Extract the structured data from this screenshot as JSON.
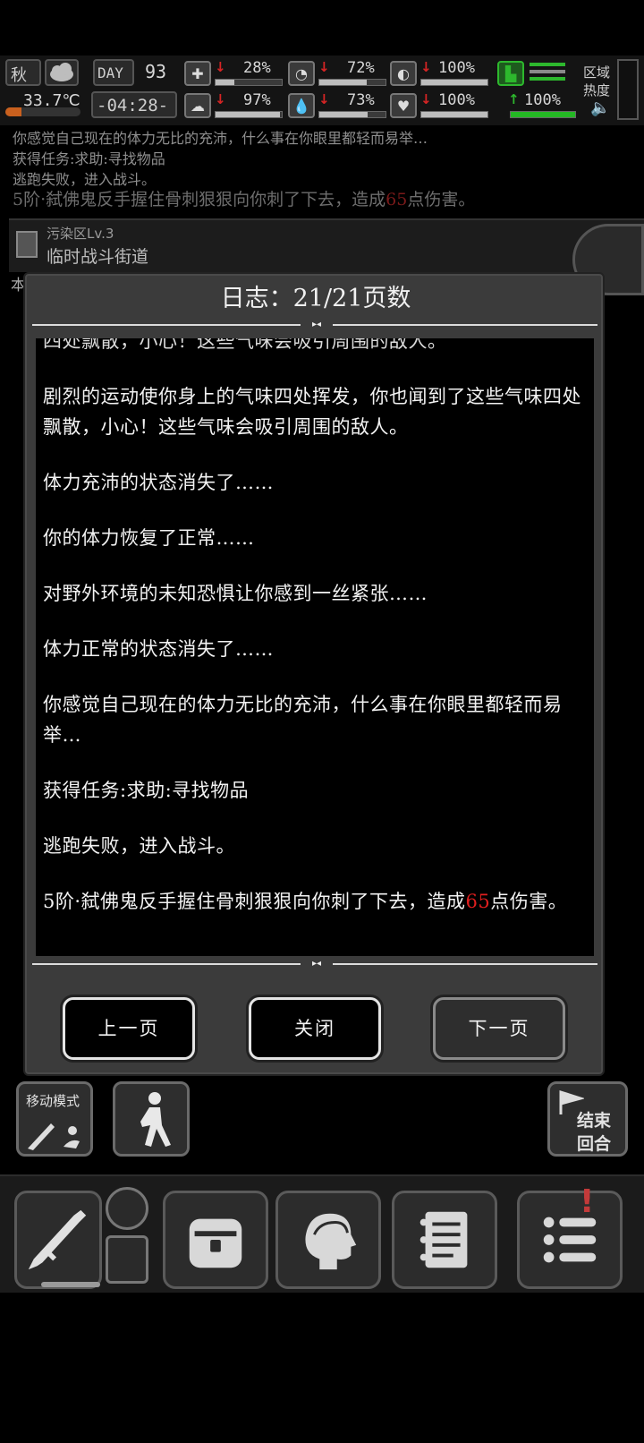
{
  "hud": {
    "season": "秋",
    "day_label": "DAY",
    "day": "93",
    "temperature": "33.7℃",
    "time": "-04:28-",
    "stats": [
      {
        "name": "health",
        "icon": "medkit-icon",
        "trend": "down",
        "value": "28%",
        "fill": 0.28
      },
      {
        "name": "hunger",
        "icon": "stomach-icon",
        "trend": "down",
        "value": "72%",
        "fill": 0.72
      },
      {
        "name": "protection",
        "icon": "armor-icon",
        "trend": "down",
        "value": "100%",
        "fill": 1.0
      },
      {
        "name": "sanity",
        "icon": "brain-icon",
        "trend": "down",
        "value": "97%",
        "fill": 0.97
      },
      {
        "name": "thirst",
        "icon": "water-drop-icon",
        "trend": "down",
        "value": "73%",
        "fill": 0.73
      },
      {
        "name": "heart",
        "icon": "heart-icon",
        "trend": "down",
        "value": "100%",
        "fill": 1.0
      },
      {
        "name": "stamina",
        "icon": "boot-icon",
        "trend": "up",
        "value": "100%",
        "fill": 1.0
      }
    ],
    "zone_heat_label_1": "区域",
    "zone_heat_label_2": "热度"
  },
  "messages": {
    "line1": "你感觉自己现在的体力无比的充沛，什么事在你眼里都轻而易举…",
    "line2": "获得任务:求助:寻找物品",
    "line3": "逃跑失败，进入战斗。",
    "line4_prefix": "5阶·弑佛鬼反手握住骨刺狠狠向你刺了下去，造成",
    "line4_dmg": "65",
    "line4_suffix": "点伤害。"
  },
  "zone": {
    "level": "污染区Lv.3",
    "name": "临时战斗街道",
    "side_char": "本"
  },
  "dialog": {
    "title": "日志：21/21页数",
    "entries": [
      "四处飘散，小心！这些气味会吸引周围的敌人。",
      "剧烈的运动使你身上的气味四处挥发，你也闻到了这些气味四处飘散，小心！这些气味会吸引周围的敌人。",
      "体力充沛的状态消失了……",
      "你的体力恢复了正常……",
      "对野外环境的未知恐惧让你感到一丝紧张……",
      "体力正常的状态消失了……",
      "你感觉自己现在的体力无比的充沛，什么事在你眼里都轻而易举…",
      "获得任务:求助:寻找物品",
      "逃跑失败，进入战斗。"
    ],
    "last_entry": {
      "prefix": "5阶·弑佛鬼反手握住骨刺狠狠向你刺了下去，造成",
      "damage": "65",
      "suffix": "点伤害。"
    },
    "prev_label": "上一页",
    "close_label": "关闭",
    "next_label": "下一页"
  },
  "controls": {
    "move_mode_label": "移动模式",
    "end_turn_line1": "结束",
    "end_turn_line2": "回合"
  },
  "colors": {
    "damage": "#e01f1f",
    "trend_down": "#d62424",
    "trend_up": "#2db82d"
  }
}
